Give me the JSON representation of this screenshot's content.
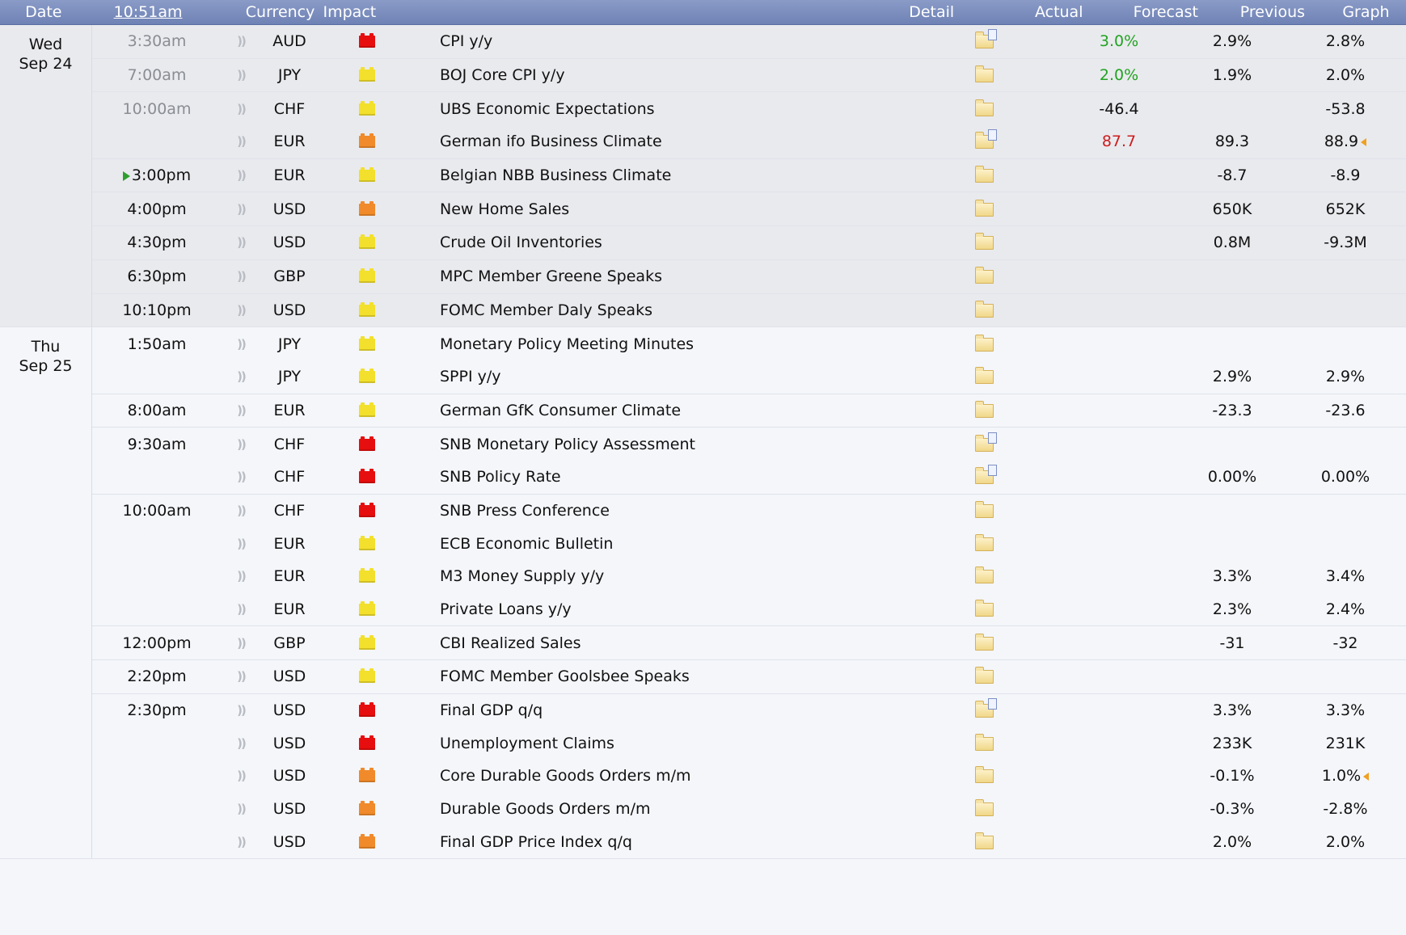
{
  "header": {
    "date": "Date",
    "time": "10:51am",
    "currency": "Currency",
    "impact": "Impact",
    "detail": "Detail",
    "actual": "Actual",
    "forecast": "Forecast",
    "previous": "Previous",
    "graph": "Graph"
  },
  "colors": {
    "impact_high": "#e60e0e",
    "impact_medium": "#f08a2a",
    "impact_low": "#f2e02c",
    "actual_better": "#21a321",
    "actual_worse": "#cc1d1d",
    "header_bg": "#7a8cbc"
  },
  "icons": {
    "sound": "speaker-icon",
    "detail": "folder-icon",
    "graph": "bar-graph-icon",
    "revised": "revision-arrow-icon",
    "next": "next-event-arrow-icon"
  },
  "days": [
    {
      "weekday": "Wed",
      "date": "Sep 24",
      "events": [
        {
          "time": "3:30am",
          "past": true,
          "currency": "AUD",
          "impact": "high",
          "event": "CPI y/y",
          "detail": "doc",
          "actual": "3.0%",
          "actual_color": "green",
          "forecast": "2.9%",
          "previous": "2.8%",
          "graph": true,
          "sep": false
        },
        {
          "time": "7:00am",
          "past": true,
          "currency": "JPY",
          "impact": "low",
          "event": "BOJ Core CPI y/y",
          "detail": "folder",
          "actual": "2.0%",
          "actual_color": "green",
          "forecast": "1.9%",
          "previous": "2.0%",
          "graph": true,
          "sep": true
        },
        {
          "time": "10:00am",
          "past": true,
          "currency": "CHF",
          "impact": "low",
          "event": "UBS Economic Expectations",
          "detail": "folder",
          "actual": "-46.4",
          "actual_color": "",
          "forecast": "",
          "previous": "-53.8",
          "graph": true,
          "sep": true
        },
        {
          "time": "",
          "past": true,
          "currency": "EUR",
          "impact": "medium",
          "event": "German ifo Business Climate",
          "detail": "doc",
          "actual": "87.7",
          "actual_color": "red",
          "forecast": "89.3",
          "previous": "88.9",
          "revised": true,
          "graph": true,
          "sep": false
        },
        {
          "time": "3:00pm",
          "past": false,
          "next": true,
          "currency": "EUR",
          "impact": "low",
          "event": "Belgian NBB Business Climate",
          "detail": "folder",
          "actual": "",
          "actual_color": "",
          "forecast": "-8.7",
          "previous": "-8.9",
          "graph": true,
          "sep": true
        },
        {
          "time": "4:00pm",
          "past": false,
          "currency": "USD",
          "impact": "medium",
          "event": "New Home Sales",
          "detail": "folder",
          "actual": "",
          "actual_color": "",
          "forecast": "650K",
          "previous": "652K",
          "graph": true,
          "sep": true
        },
        {
          "time": "4:30pm",
          "past": false,
          "currency": "USD",
          "impact": "low",
          "event": "Crude Oil Inventories",
          "detail": "folder",
          "actual": "",
          "actual_color": "",
          "forecast": "0.8M",
          "previous": "-9.3M",
          "graph": true,
          "sep": true
        },
        {
          "time": "6:30pm",
          "past": false,
          "currency": "GBP",
          "impact": "low",
          "event": "MPC Member Greene Speaks",
          "detail": "folder",
          "actual": "",
          "actual_color": "",
          "forecast": "",
          "previous": "",
          "graph": false,
          "sep": true
        },
        {
          "time": "10:10pm",
          "past": false,
          "currency": "USD",
          "impact": "low",
          "event": "FOMC Member Daly Speaks",
          "detail": "folder",
          "actual": "",
          "actual_color": "",
          "forecast": "",
          "previous": "",
          "graph": false,
          "sep": true
        }
      ]
    },
    {
      "weekday": "Thu",
      "date": "Sep 25",
      "events": [
        {
          "time": "1:50am",
          "past": false,
          "currency": "JPY",
          "impact": "low",
          "event": "Monetary Policy Meeting Minutes",
          "detail": "folder",
          "actual": "",
          "actual_color": "",
          "forecast": "",
          "previous": "",
          "graph": false,
          "sep": false
        },
        {
          "time": "",
          "past": false,
          "currency": "JPY",
          "impact": "low",
          "event": "SPPI y/y",
          "detail": "folder",
          "actual": "",
          "actual_color": "",
          "forecast": "2.9%",
          "previous": "2.9%",
          "graph": true,
          "sep": false
        },
        {
          "time": "8:00am",
          "past": false,
          "currency": "EUR",
          "impact": "low",
          "event": "German GfK Consumer Climate",
          "detail": "folder",
          "actual": "",
          "actual_color": "",
          "forecast": "-23.3",
          "previous": "-23.6",
          "graph": true,
          "sep": true
        },
        {
          "time": "9:30am",
          "past": false,
          "currency": "CHF",
          "impact": "high",
          "event": "SNB Monetary Policy Assessment",
          "detail": "doc",
          "actual": "",
          "actual_color": "",
          "forecast": "",
          "previous": "",
          "graph": false,
          "sep": true
        },
        {
          "time": "",
          "past": false,
          "currency": "CHF",
          "impact": "high",
          "event": "SNB Policy Rate",
          "detail": "doc",
          "actual": "",
          "actual_color": "",
          "forecast": "0.00%",
          "previous": "0.00%",
          "graph": true,
          "sep": false
        },
        {
          "time": "10:00am",
          "past": false,
          "currency": "CHF",
          "impact": "high",
          "event": "SNB Press Conference",
          "detail": "folder",
          "actual": "",
          "actual_color": "",
          "forecast": "",
          "previous": "",
          "graph": false,
          "sep": true
        },
        {
          "time": "",
          "past": false,
          "currency": "EUR",
          "impact": "low",
          "event": "ECB Economic Bulletin",
          "detail": "folder",
          "actual": "",
          "actual_color": "",
          "forecast": "",
          "previous": "",
          "graph": false,
          "sep": false
        },
        {
          "time": "",
          "past": false,
          "currency": "EUR",
          "impact": "low",
          "event": "M3 Money Supply y/y",
          "detail": "folder",
          "actual": "",
          "actual_color": "",
          "forecast": "3.3%",
          "previous": "3.4%",
          "graph": true,
          "sep": false
        },
        {
          "time": "",
          "past": false,
          "currency": "EUR",
          "impact": "low",
          "event": "Private Loans y/y",
          "detail": "folder",
          "actual": "",
          "actual_color": "",
          "forecast": "2.3%",
          "previous": "2.4%",
          "graph": true,
          "sep": false
        },
        {
          "time": "12:00pm",
          "past": false,
          "currency": "GBP",
          "impact": "low",
          "event": "CBI Realized Sales",
          "detail": "folder",
          "actual": "",
          "actual_color": "",
          "forecast": "-31",
          "previous": "-32",
          "graph": true,
          "sep": true
        },
        {
          "time": "2:20pm",
          "past": false,
          "currency": "USD",
          "impact": "low",
          "event": "FOMC Member Goolsbee Speaks",
          "detail": "folder",
          "actual": "",
          "actual_color": "",
          "forecast": "",
          "previous": "",
          "graph": false,
          "sep": true
        },
        {
          "time": "2:30pm",
          "past": false,
          "currency": "USD",
          "impact": "high",
          "event": "Final GDP q/q",
          "detail": "doc",
          "actual": "",
          "actual_color": "",
          "forecast": "3.3%",
          "previous": "3.3%",
          "graph": true,
          "sep": true
        },
        {
          "time": "",
          "past": false,
          "currency": "USD",
          "impact": "high",
          "event": "Unemployment Claims",
          "detail": "folder",
          "actual": "",
          "actual_color": "",
          "forecast": "233K",
          "previous": "231K",
          "graph": true,
          "sep": false
        },
        {
          "time": "",
          "past": false,
          "currency": "USD",
          "impact": "medium",
          "event": "Core Durable Goods Orders m/m",
          "detail": "folder",
          "actual": "",
          "actual_color": "",
          "forecast": "-0.1%",
          "previous": "1.0%",
          "revised": true,
          "graph": true,
          "sep": false
        },
        {
          "time": "",
          "past": false,
          "currency": "USD",
          "impact": "medium",
          "event": "Durable Goods Orders m/m",
          "detail": "folder",
          "actual": "",
          "actual_color": "",
          "forecast": "-0.3%",
          "previous": "-2.8%",
          "graph": true,
          "sep": false
        },
        {
          "time": "",
          "past": false,
          "currency": "USD",
          "impact": "medium",
          "event": "Final GDP Price Index q/q",
          "detail": "folder",
          "actual": "",
          "actual_color": "",
          "forecast": "2.0%",
          "previous": "2.0%",
          "graph": true,
          "sep": false
        }
      ]
    }
  ]
}
